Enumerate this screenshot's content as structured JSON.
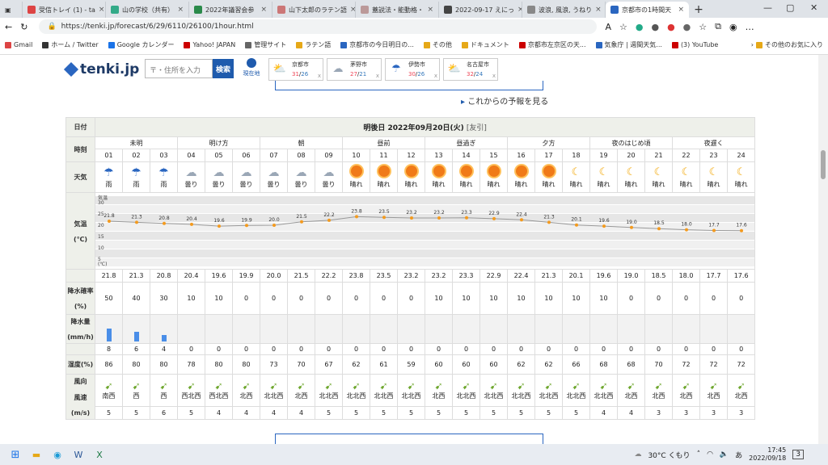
{
  "browser": {
    "tabs": [
      {
        "label": "受信トレイ (1) - ta",
        "color": "#d44"
      },
      {
        "label": "山の学校（共有）",
        "color": "#3a8"
      },
      {
        "label": "2022年議習会参",
        "color": "#2a8a4a"
      },
      {
        "label": "山下太郎のラテン語",
        "color": "#c77"
      },
      {
        "label": "蓋説法・能動格・",
        "color": "#b99"
      },
      {
        "label": "2022-09-17 えにっ",
        "color": "#444"
      },
      {
        "label": "波浪, 風浪, うねり",
        "color": "#888"
      },
      {
        "label": "京都市の1時間天",
        "color": "#2a66c0"
      }
    ],
    "url": "https://tenki.jp/forecast/6/29/6110/26100/1hour.html",
    "bookmarks": [
      "Gmail",
      "ホーム / Twitter",
      "Google カレンダー",
      "Yahoo! JAPAN",
      "管理サイト",
      "ラテン語",
      "京都市の今日明日の...",
      "その他",
      "ドキュメント",
      "京都市左京区の天...",
      "気象庁 | 週間天気...",
      "(3) YouTube",
      "その他のお気に入り"
    ]
  },
  "site": {
    "logo": "tenki.jp",
    "search_placeholder": "〒・住所を入力",
    "search_btn": "検索",
    "current_loc": "現在地",
    "cities": [
      {
        "name": "京都市",
        "hi": "31",
        "lo": "26",
        "icon": "cloud-sun"
      },
      {
        "name": "茅野市",
        "hi": "27",
        "lo": "21",
        "icon": "cloud"
      },
      {
        "name": "伊勢市",
        "hi": "30",
        "lo": "26",
        "icon": "umbrella"
      },
      {
        "name": "名古屋市",
        "hi": "32",
        "lo": "24",
        "icon": "cloud-sun"
      }
    ],
    "city_close": "x",
    "future_link": "これからの予報を見る"
  },
  "table": {
    "date_label": "日付",
    "date": "明後日 2022年09月20日(火)",
    "rokuyo": "[友引]",
    "row_labels": {
      "time": "時刻",
      "weather": "天気",
      "temp": "気温",
      "temp_unit": "(℃)",
      "prob": "降水確率",
      "prob_unit": "(%)",
      "amount": "降水量",
      "amount_unit": "(mm/h)",
      "humidity": "湿度(%)",
      "wind": "風向",
      "wind2": "風速",
      "wind_unit": "(m/s)"
    },
    "periods": [
      {
        "label": "未明",
        "span": 3
      },
      {
        "label": "明け方",
        "span": 3
      },
      {
        "label": "朝",
        "span": 3
      },
      {
        "label": "昼前",
        "span": 3
      },
      {
        "label": "昼過ぎ",
        "span": 3
      },
      {
        "label": "夕方",
        "span": 3
      },
      {
        "label": "夜のはじめ頃",
        "span": 3
      },
      {
        "label": "夜遅く",
        "span": 3
      }
    ],
    "graph_axis": [
      "気温",
      "30",
      "25",
      "20",
      "15",
      "10",
      "5",
      "(℃)"
    ],
    "hours": [
      "01",
      "02",
      "03",
      "04",
      "05",
      "06",
      "07",
      "08",
      "09",
      "10",
      "11",
      "12",
      "13",
      "14",
      "15",
      "16",
      "17",
      "18",
      "19",
      "20",
      "21",
      "22",
      "23",
      "24"
    ],
    "weather": [
      "雨",
      "雨",
      "雨",
      "曇り",
      "曇り",
      "曇り",
      "曇り",
      "曇り",
      "曇り",
      "晴れ",
      "晴れ",
      "晴れ",
      "晴れ",
      "晴れ",
      "晴れ",
      "晴れ",
      "晴れ",
      "晴れ",
      "晴れ",
      "晴れ",
      "晴れ",
      "晴れ",
      "晴れ",
      "晴れ"
    ],
    "weather_icon": [
      "umbrella",
      "umbrella",
      "umbrella",
      "cloud",
      "cloud",
      "cloud",
      "cloud",
      "cloud",
      "cloud",
      "sun",
      "sun",
      "sun",
      "sun",
      "sun",
      "sun",
      "sun",
      "sun",
      "moon",
      "moon",
      "moon",
      "moon",
      "moon",
      "moon",
      "moon"
    ],
    "temp": [
      "21.8",
      "21.3",
      "20.8",
      "20.4",
      "19.6",
      "19.9",
      "20.0",
      "21.5",
      "22.2",
      "23.8",
      "23.5",
      "23.2",
      "23.2",
      "23.3",
      "22.9",
      "22.4",
      "21.3",
      "20.1",
      "19.6",
      "19.0",
      "18.5",
      "18.0",
      "17.7",
      "17.6"
    ],
    "prob": [
      "50",
      "40",
      "30",
      "10",
      "10",
      "0",
      "0",
      "0",
      "0",
      "0",
      "0",
      "0",
      "10",
      "10",
      "10",
      "10",
      "10",
      "10",
      "10",
      "0",
      "0",
      "0",
      "0",
      "0"
    ],
    "amount": [
      "8",
      "6",
      "4",
      "0",
      "0",
      "0",
      "0",
      "0",
      "0",
      "0",
      "0",
      "0",
      "0",
      "0",
      "0",
      "0",
      "0",
      "0",
      "0",
      "0",
      "0",
      "0",
      "0",
      "0"
    ],
    "humidity": [
      "86",
      "80",
      "80",
      "78",
      "80",
      "80",
      "73",
      "70",
      "67",
      "62",
      "61",
      "59",
      "60",
      "60",
      "60",
      "62",
      "62",
      "66",
      "68",
      "68",
      "70",
      "72",
      "72",
      "72"
    ],
    "wind_dir": [
      "南西",
      "西",
      "西",
      "西北西",
      "西北西",
      "北西",
      "北北西",
      "北西",
      "北北西",
      "北北西",
      "北北西",
      "北北西",
      "北西",
      "北北西",
      "北北西",
      "北北西",
      "北北西",
      "北北西",
      "北北西",
      "北西",
      "北西",
      "北西",
      "北西",
      "北西"
    ],
    "wind_speed": [
      "5",
      "5",
      "6",
      "5",
      "4",
      "4",
      "4",
      "4",
      "5",
      "5",
      "5",
      "5",
      "5",
      "5",
      "5",
      "5",
      "5",
      "5",
      "4",
      "4",
      "3",
      "3",
      "3",
      "3"
    ]
  },
  "taskbar": {
    "weather": "30°C くもり",
    "time": "17:45",
    "date": "2022/09/18",
    "ime": "あ",
    "notif": "3"
  }
}
